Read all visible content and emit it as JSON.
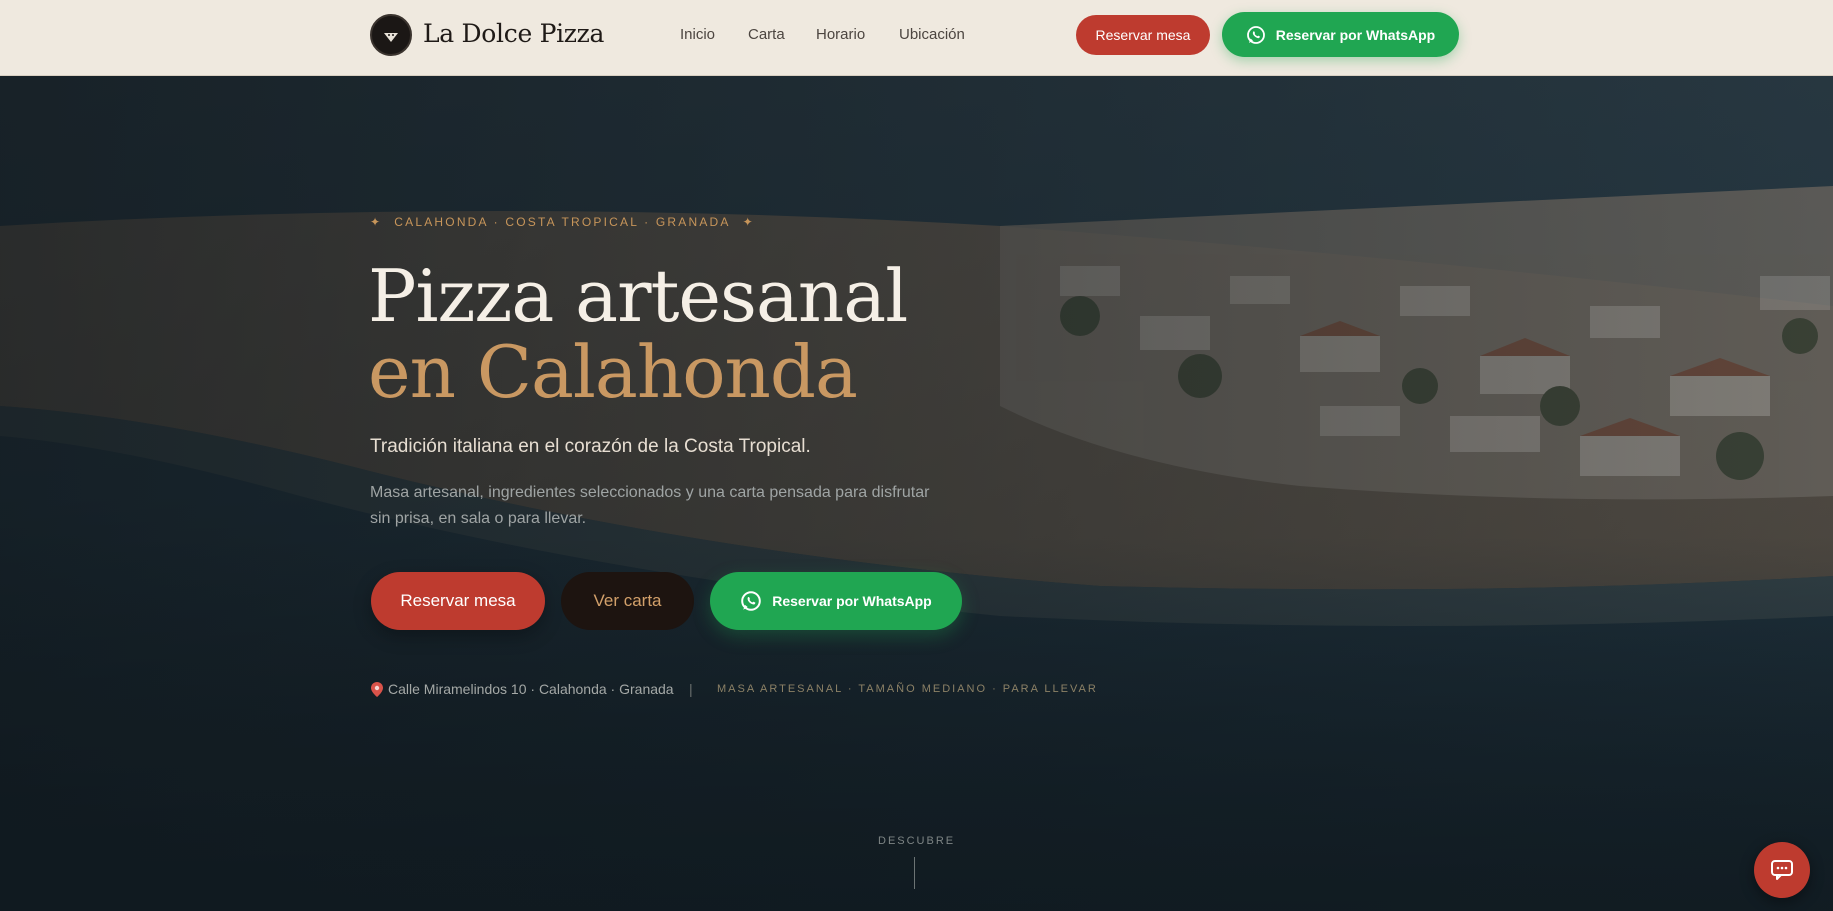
{
  "header": {
    "brand": "La Dolce Pizza",
    "logo_text": "La Dolce Pizza",
    "nav": [
      "Inicio",
      "Carta",
      "Horario",
      "Ubicación"
    ],
    "reserve_label": "Reservar mesa",
    "whatsapp_label": "Reservar por WhatsApp"
  },
  "hero": {
    "eyebrow": "CALAHONDA · COSTA TROPICAL · GRANADA",
    "title_line1": "Pizza artesanal",
    "title_line2": "en Calahonda",
    "tagline": "Tradición italiana en el corazón de la Costa Tropical.",
    "description": "Masa artesanal, ingredientes seleccionados y una carta pensada para disfrutar sin prisa, en sala o para llevar.",
    "cta_reserve": "Reservar mesa",
    "cta_menu": "Ver carta",
    "cta_whatsapp": "Reservar por WhatsApp",
    "address": "Calle Miramelindos 10 · Calahonda · Granada",
    "separator": "|",
    "features": "MASA ARTESANAL · TAMAÑO MEDIANO · PARA LLEVAR",
    "scroll_label": "DESCUBRE"
  },
  "colors": {
    "accent_red": "#be3b2f",
    "whatsapp_green": "#20a652",
    "gold": "#c99862",
    "header_bg": "#efe9df"
  },
  "icons": {
    "whatsapp": "whatsapp-icon",
    "pin": "map-pin-icon",
    "chat": "chat-icon",
    "eyebrow_star": "star-icon"
  }
}
